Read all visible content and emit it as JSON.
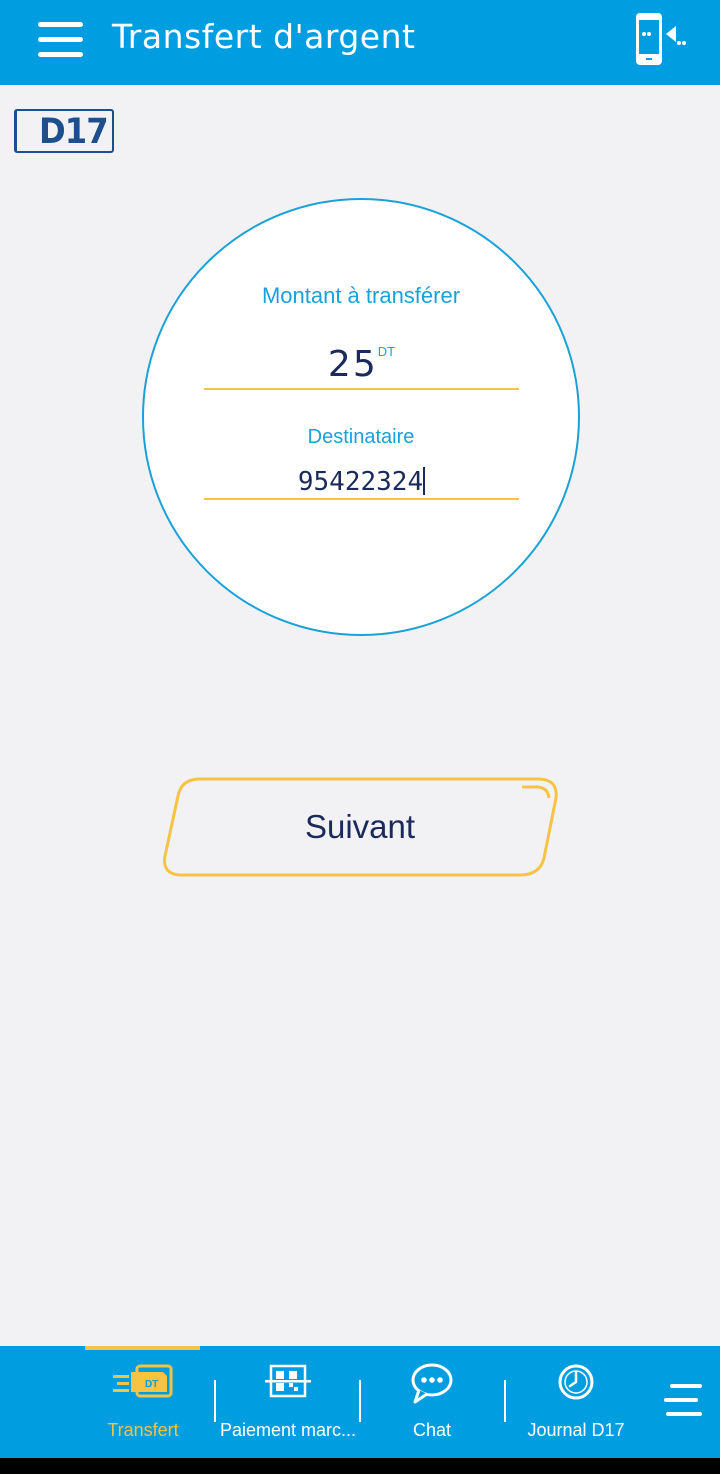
{
  "header": {
    "menu_icon": "hamburger-menu-icon",
    "title": "Transfert d'argent",
    "action_icon": "phone-transfer-icon"
  },
  "logo": {
    "text": "D17"
  },
  "form": {
    "amount_label": "Montant à transférer",
    "amount_value": "25",
    "amount_unit": "DT",
    "recipient_label": "Destinataire",
    "recipient_value": "95422324"
  },
  "next_button": {
    "label": "Suivant"
  },
  "bottom_nav": {
    "items": [
      {
        "label": "Transfert",
        "icon": "dt-card-transfer-icon",
        "active": true
      },
      {
        "label": "Paiement marc...",
        "icon": "qr-code-icon",
        "active": false
      },
      {
        "label": "Chat",
        "icon": "chat-bubble-icon",
        "active": false
      },
      {
        "label": "Journal D17",
        "icon": "clock-icon",
        "active": false
      }
    ],
    "more_icon": "menu-lines-icon"
  },
  "colors": {
    "primary": "#009ee0",
    "accent": "#f6c343",
    "text_dark": "#1b2a5a",
    "logo_blue": "#1d4f8c",
    "background": "#f2f2f4"
  }
}
